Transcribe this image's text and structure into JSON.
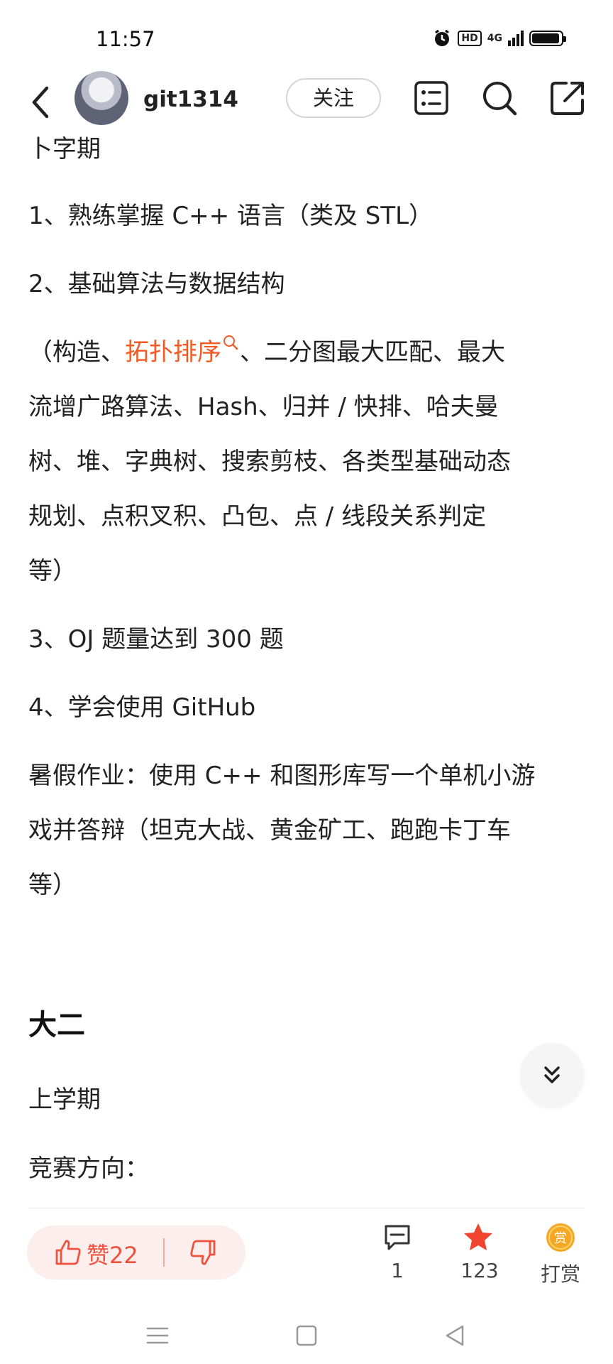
{
  "status_bar": {
    "time": "11:57",
    "hd_label": "HD",
    "network": "4G",
    "battery_level": 0.95
  },
  "header": {
    "username": "git1314",
    "follow_label": "关注"
  },
  "article": {
    "cut_line": "卜字期",
    "item1": "1、熟练掌握 C++ 语言（类及 STL）",
    "item2": "2、基础算法与数据结构",
    "algo_prefix": "（构造、",
    "algo_link": "拓扑排序",
    "algo_suffix": "、二分图最大匹配、最大",
    "algo_line2": "流增广路算法、Hash、归并 / 快排、哈夫曼",
    "algo_line3": "树、堆、字典树、搜索剪枝、各类型基础动态",
    "algo_line4": "规划、点积叉积、凸包、点 / 线段关系判定",
    "algo_line5": "等）",
    "item3": "3、OJ 题量达到 300 题",
    "item4": "4、学会使用 GitHub",
    "summer_line1": "暑假作业：使用 C++ 和图形库写一个单机小游",
    "summer_line2": "戏并答辩（坦克大战、黄金矿工、跑跑卡丁车",
    "summer_line3": "等）",
    "heading": "大二",
    "term": "上学期",
    "direction": "竞赛方向："
  },
  "actions": {
    "like_label": "赞22",
    "comment_count": "1",
    "favorite_count": "123",
    "reward_label": "打赏",
    "reward_badge": "赏"
  },
  "colors": {
    "accent": "#f15a24",
    "like_bg": "#fdeeee",
    "like_text": "#f0523e",
    "reward_gold": "#f5a623"
  },
  "icons": [
    "back-icon",
    "list-icon",
    "search-icon",
    "share-icon",
    "collapse-icon",
    "thumb-up-icon",
    "thumb-down-icon",
    "comment-icon",
    "star-icon",
    "reward-icon",
    "menu-icon",
    "home-icon",
    "back-nav-icon"
  ]
}
